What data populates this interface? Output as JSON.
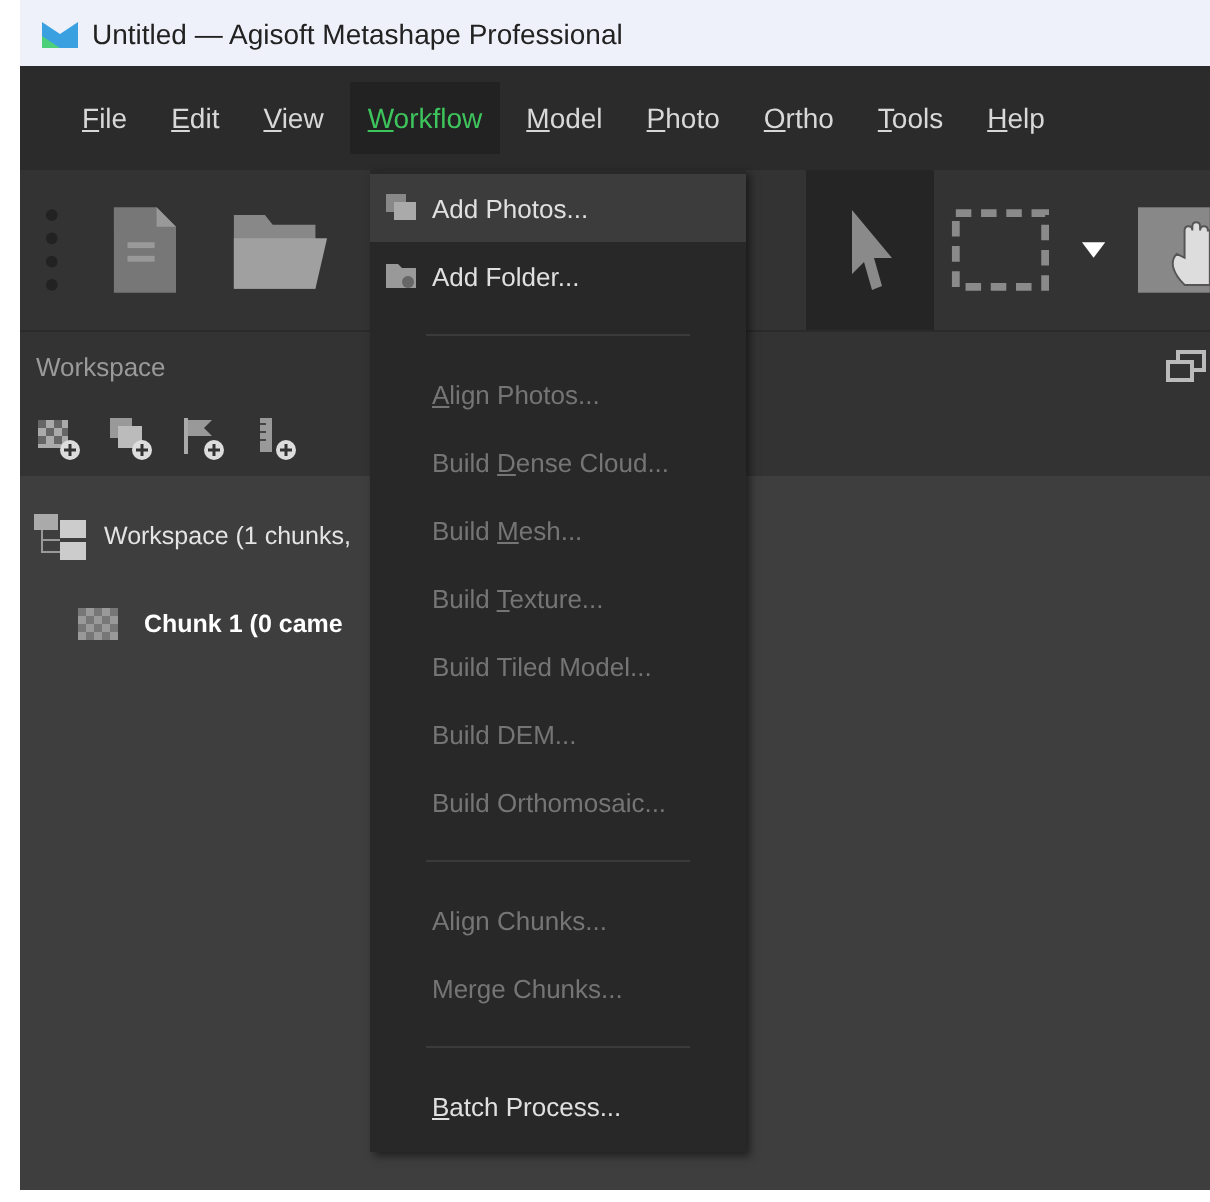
{
  "window": {
    "title": "Untitled — Agisoft Metashape Professional"
  },
  "menu_bar": [
    {
      "key": "F",
      "post": "ile",
      "selected": false
    },
    {
      "key": "E",
      "post": "dit",
      "selected": false
    },
    {
      "key": "V",
      "post": "iew",
      "selected": false
    },
    {
      "key": "W",
      "post": "orkflow",
      "selected": true
    },
    {
      "key": "M",
      "post": "odel",
      "selected": false
    },
    {
      "key": "P",
      "post": "hoto",
      "selected": false
    },
    {
      "key": "O",
      "post": "rtho",
      "selected": false
    },
    {
      "key": "T",
      "post": "ools",
      "selected": false
    },
    {
      "key": "H",
      "post": "elp",
      "selected": false
    }
  ],
  "workspace": {
    "title": "Workspace",
    "tree": [
      {
        "label": "Workspace (1 chunks,",
        "children": [
          {
            "label": "Chunk 1 (0 came"
          }
        ]
      }
    ]
  },
  "workflow_menu": [
    {
      "kind": "item",
      "pre": "Add Photos...",
      "disabled": false,
      "selected": true
    },
    {
      "kind": "item",
      "pre": "Add Folder...",
      "disabled": false,
      "selected": false
    },
    {
      "kind": "separator"
    },
    {
      "kind": "item",
      "key": "A",
      "post": "lign Photos...",
      "disabled": true,
      "selected": false
    },
    {
      "kind": "item",
      "pre": "Build ",
      "key": "D",
      "post": "ense Cloud...",
      "disabled": true,
      "selected": false
    },
    {
      "kind": "item",
      "pre": "Build ",
      "key": "M",
      "post": "esh...",
      "disabled": true,
      "selected": false
    },
    {
      "kind": "item",
      "pre": "Build ",
      "key": "T",
      "post": "exture...",
      "disabled": true,
      "selected": false
    },
    {
      "kind": "item",
      "pre": "Build Tiled Model...",
      "disabled": true,
      "selected": false
    },
    {
      "kind": "item",
      "pre": "Build DEM...",
      "disabled": true,
      "selected": false
    },
    {
      "kind": "item",
      "pre": "Build Orthomosaic...",
      "disabled": true,
      "selected": false
    },
    {
      "kind": "separator"
    },
    {
      "kind": "item",
      "pre": "Align Chunks...",
      "disabled": true,
      "selected": false
    },
    {
      "kind": "item",
      "pre": "Merge Chunks...",
      "disabled": true,
      "selected": false
    },
    {
      "kind": "separator"
    },
    {
      "kind": "item",
      "key": "B",
      "post": "atch Process...",
      "disabled": false,
      "selected": false
    }
  ]
}
